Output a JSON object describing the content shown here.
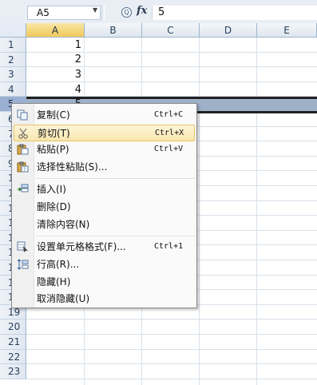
{
  "formula_bar": {
    "name_box": "A5",
    "zoom_glyph": "Q",
    "fx_label": "fx",
    "formula_value": "5"
  },
  "columns": [
    "A",
    "B",
    "C",
    "D",
    "E"
  ],
  "rows": [
    "1",
    "2",
    "3",
    "4",
    "5",
    "6",
    "7",
    "8",
    "9",
    "10",
    "11",
    "12",
    "13",
    "14",
    "15",
    "16",
    "17",
    "18",
    "19",
    "20",
    "21",
    "22",
    "23"
  ],
  "cells": {
    "A1": "1",
    "A2": "2",
    "A3": "3",
    "A4": "4",
    "A5": "5"
  },
  "selected_row": "5",
  "selected_column": "A",
  "context_menu": {
    "items": [
      {
        "label": "复制(C)",
        "shortcut": "Ctrl+C",
        "icon": "copy-icon"
      },
      {
        "label": "剪切(T)",
        "shortcut": "Ctrl+X",
        "icon": "scissors-icon"
      },
      {
        "label": "粘贴(P)",
        "shortcut": "Ctrl+V",
        "icon": "paste-icon"
      },
      {
        "label": "选择性粘贴(S)...",
        "shortcut": "",
        "icon": "paste-special-icon"
      },
      {
        "label": "插入(I)",
        "shortcut": "",
        "icon": "insert-icon"
      },
      {
        "label": "删除(D)",
        "shortcut": "",
        "icon": ""
      },
      {
        "label": "清除内容(N)",
        "shortcut": "",
        "icon": ""
      },
      {
        "label": "设置单元格格式(F)...",
        "shortcut": "Ctrl+1",
        "icon": "format-cells-icon"
      },
      {
        "label": "行高(R)...",
        "shortcut": "",
        "icon": "row-height-icon"
      },
      {
        "label": "隐藏(H)",
        "shortcut": "",
        "icon": ""
      },
      {
        "label": "取消隐藏(U)",
        "shortcut": "",
        "icon": ""
      }
    ],
    "highlighted": "剪切(T)"
  },
  "colors": {
    "header_selected": "#f1c85b",
    "row_selected": "#9ab0d2",
    "menu_highlight": "#f8e7ae"
  }
}
